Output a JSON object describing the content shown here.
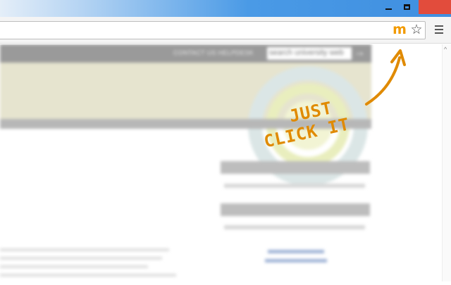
{
  "browser": {
    "titlebar": {
      "minimize_icon": "minimize-icon",
      "restore_icon": "restore-icon",
      "close_icon": "close-icon",
      "close_color": "#e24c3c"
    },
    "toolbar": {
      "address_value": "",
      "extension_icon": {
        "name": "m-extension-icon",
        "glyph": "m",
        "color": "#f29a00"
      },
      "bookmark_icon": {
        "name": "star-icon",
        "glyph": "☆"
      },
      "menu_icon": "hamburger-menu-icon"
    }
  },
  "page": {
    "header": {
      "nav_text": "CONTACT US  HELPDESK",
      "search_placeholder": "search university web",
      "search_arrow": "→"
    }
  },
  "annotation": {
    "line1": "JUST",
    "line2": "CLICK IT",
    "color": "#e08a00"
  }
}
